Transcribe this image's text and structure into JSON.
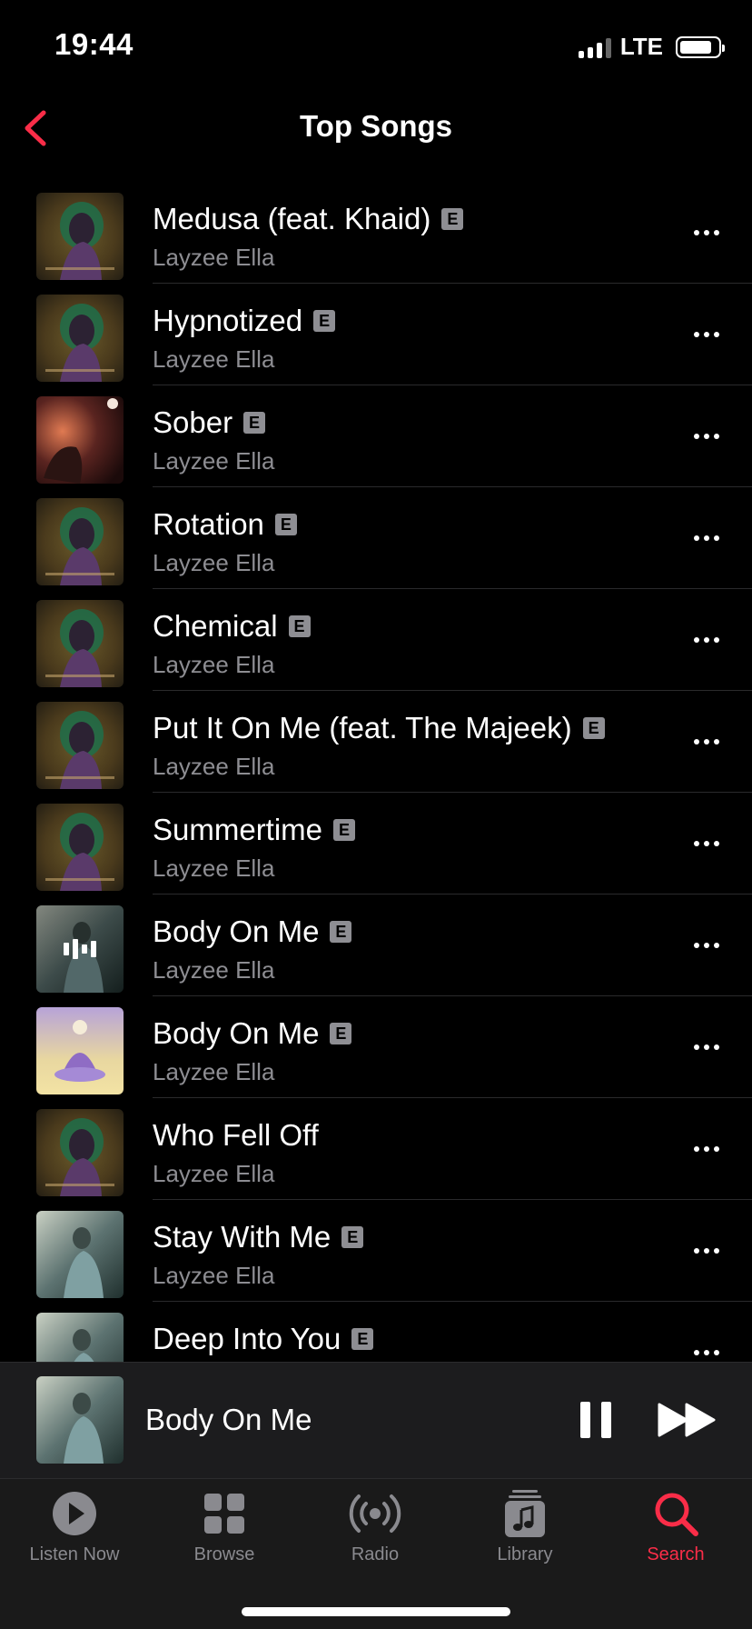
{
  "status_bar": {
    "time": "19:44",
    "network": "LTE",
    "battery_level": 0.85
  },
  "nav": {
    "title": "Top Songs",
    "back_icon": "chevron-left-icon"
  },
  "colors": {
    "accent": "#fa2d48",
    "background": "#000000",
    "secondary_text": "#8d8d92"
  },
  "explicit_badge": "E",
  "songs": [
    {
      "title": "Medusa (feat. Khaid)",
      "artist": "Layzee Ella",
      "explicit": true,
      "artwork": "green"
    },
    {
      "title": "Hypnotized",
      "artist": "Layzee Ella",
      "explicit": true,
      "artwork": "green"
    },
    {
      "title": "Sober",
      "artist": "Layzee Ella",
      "explicit": true,
      "artwork": "sober"
    },
    {
      "title": "Rotation",
      "artist": "Layzee Ella",
      "explicit": true,
      "artwork": "green"
    },
    {
      "title": "Chemical",
      "artist": "Layzee Ella",
      "explicit": true,
      "artwork": "green"
    },
    {
      "title": "Put It On Me (feat. The Majeek)",
      "artist": "Layzee Ella",
      "explicit": true,
      "artwork": "green"
    },
    {
      "title": "Summertime",
      "artist": "Layzee Ella",
      "explicit": true,
      "artwork": "green"
    },
    {
      "title": "Body On Me",
      "artist": "Layzee Ella",
      "explicit": true,
      "artwork": "teal",
      "now_playing": true
    },
    {
      "title": "Body On Me",
      "artist": "Layzee Ella",
      "explicit": true,
      "artwork": "purple"
    },
    {
      "title": "Who Fell Off",
      "artist": "Layzee Ella",
      "explicit": false,
      "artwork": "green"
    },
    {
      "title": "Stay With Me",
      "artist": "Layzee Ella",
      "explicit": true,
      "artwork": "teal"
    },
    {
      "title": "Deep Into You",
      "artist": "Layzee Ella",
      "explicit": true,
      "artwork": "teal"
    }
  ],
  "mini_player": {
    "title": "Body On Me",
    "state": "playing"
  },
  "tabs": [
    {
      "label": "Listen Now",
      "icon": "play-circle-icon",
      "active": false
    },
    {
      "label": "Browse",
      "icon": "grid-icon",
      "active": false
    },
    {
      "label": "Radio",
      "icon": "radio-waves-icon",
      "active": false
    },
    {
      "label": "Library",
      "icon": "music-note-stack-icon",
      "active": false
    },
    {
      "label": "Search",
      "icon": "search-icon",
      "active": true
    }
  ]
}
